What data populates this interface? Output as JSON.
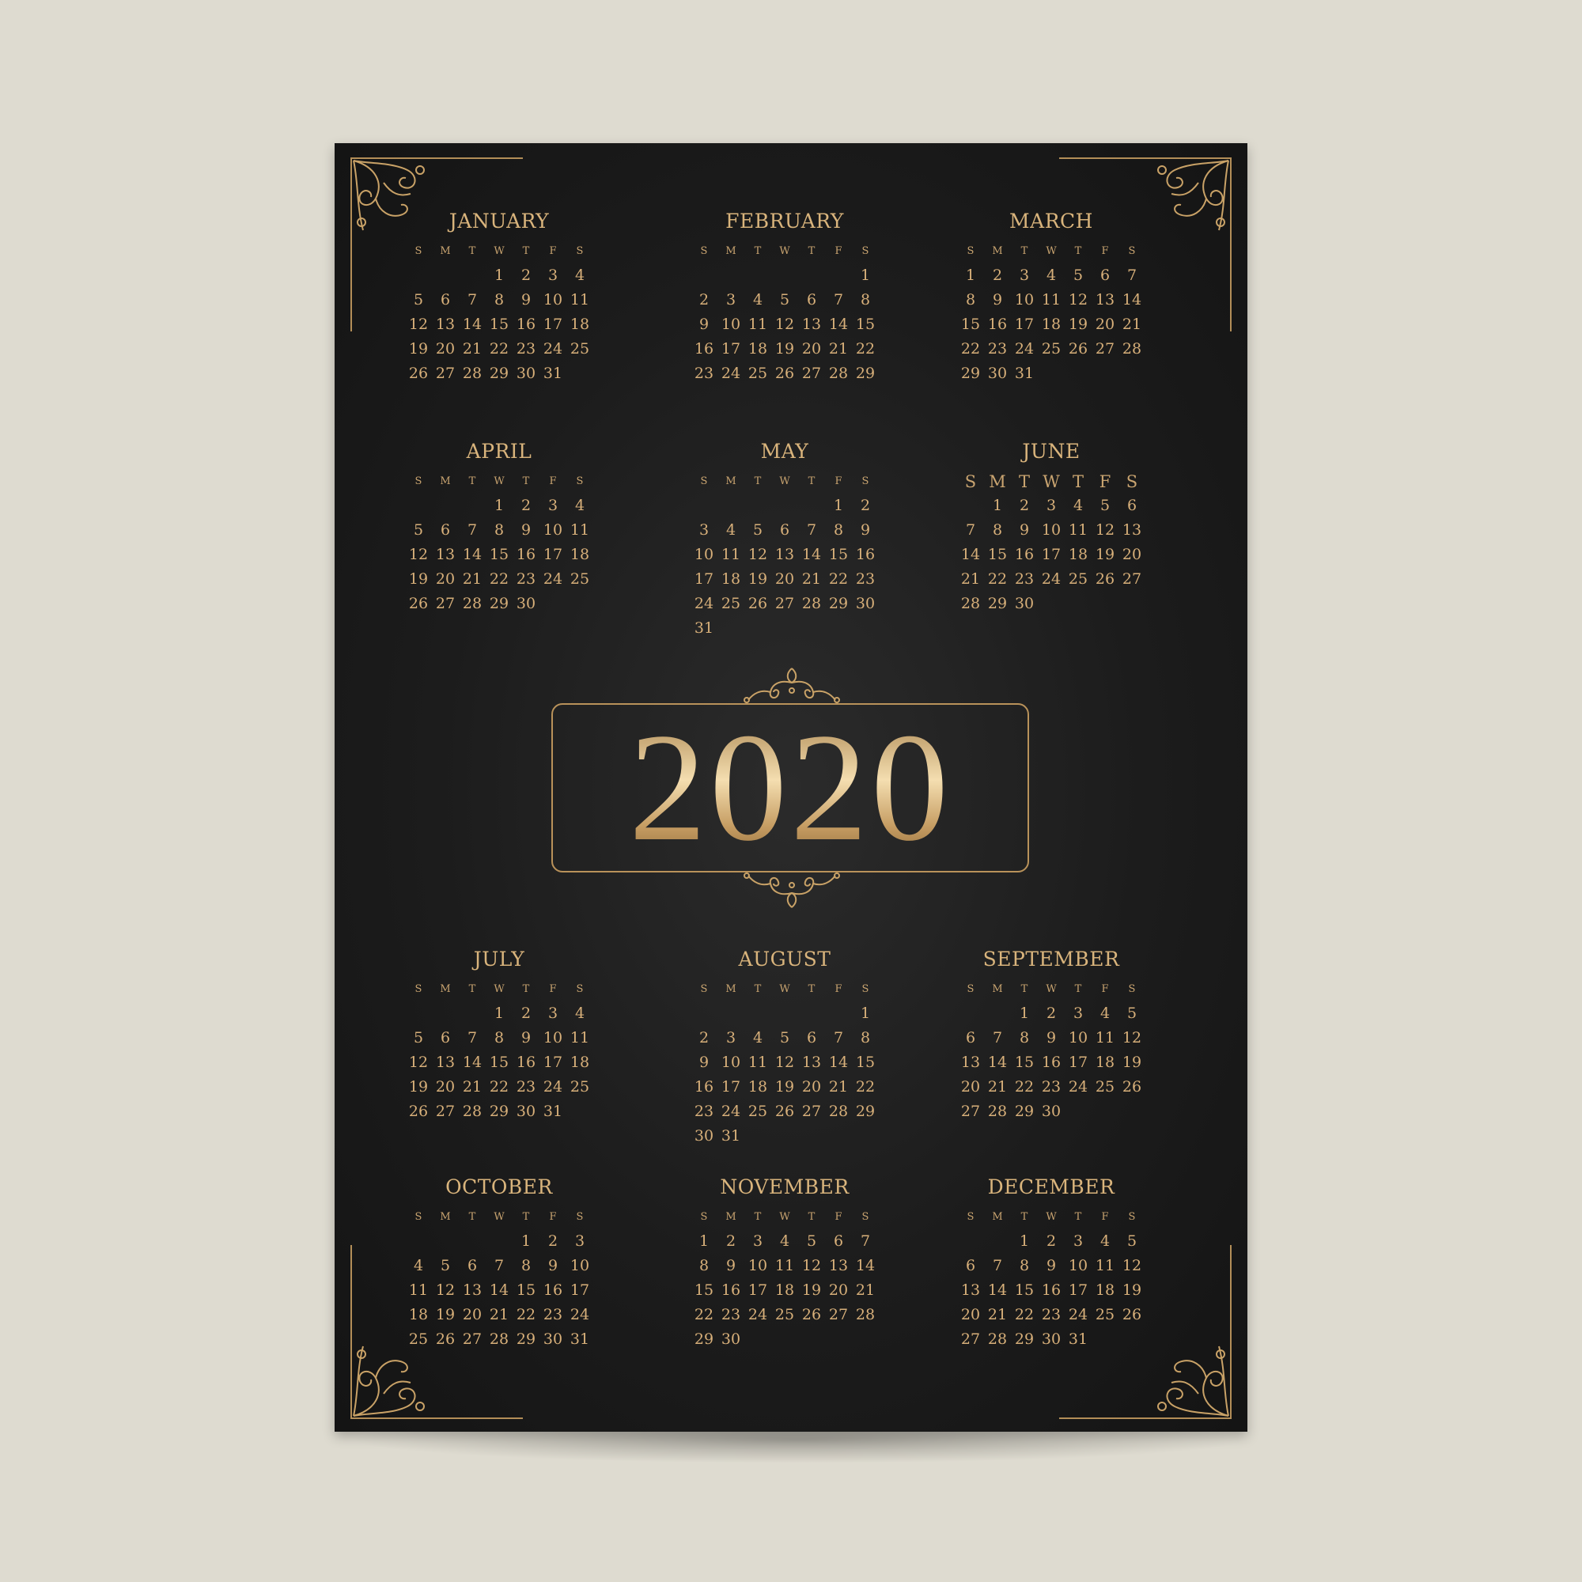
{
  "year": "2020",
  "colors": {
    "background": "#dedbd0",
    "poster": "#1c1c1c",
    "gold": "#d7b27a"
  },
  "weekday_headers": [
    "S",
    "M",
    "T",
    "W",
    "T",
    "F",
    "S"
  ],
  "months": [
    {
      "name": "JANUARY",
      "offset": 3,
      "days": 31
    },
    {
      "name": "FEBRUARY",
      "offset": 6,
      "days": 29
    },
    {
      "name": "MARCH",
      "offset": 0,
      "days": 31
    },
    {
      "name": "APRIL",
      "offset": 3,
      "days": 30
    },
    {
      "name": "MAY",
      "offset": 5,
      "days": 31
    },
    {
      "name": "JUNE",
      "offset": 1,
      "days": 30
    },
    {
      "name": "JULY",
      "offset": 3,
      "days": 31
    },
    {
      "name": "AUGUST",
      "offset": 6,
      "days": 31
    },
    {
      "name": "SEPTEMBER",
      "offset": 2,
      "days": 30
    },
    {
      "name": "OCTOBER",
      "offset": 4,
      "days": 31
    },
    {
      "name": "NOVEMBER",
      "offset": 0,
      "days": 30
    },
    {
      "name": "DECEMBER",
      "offset": 2,
      "days": 31
    }
  ]
}
